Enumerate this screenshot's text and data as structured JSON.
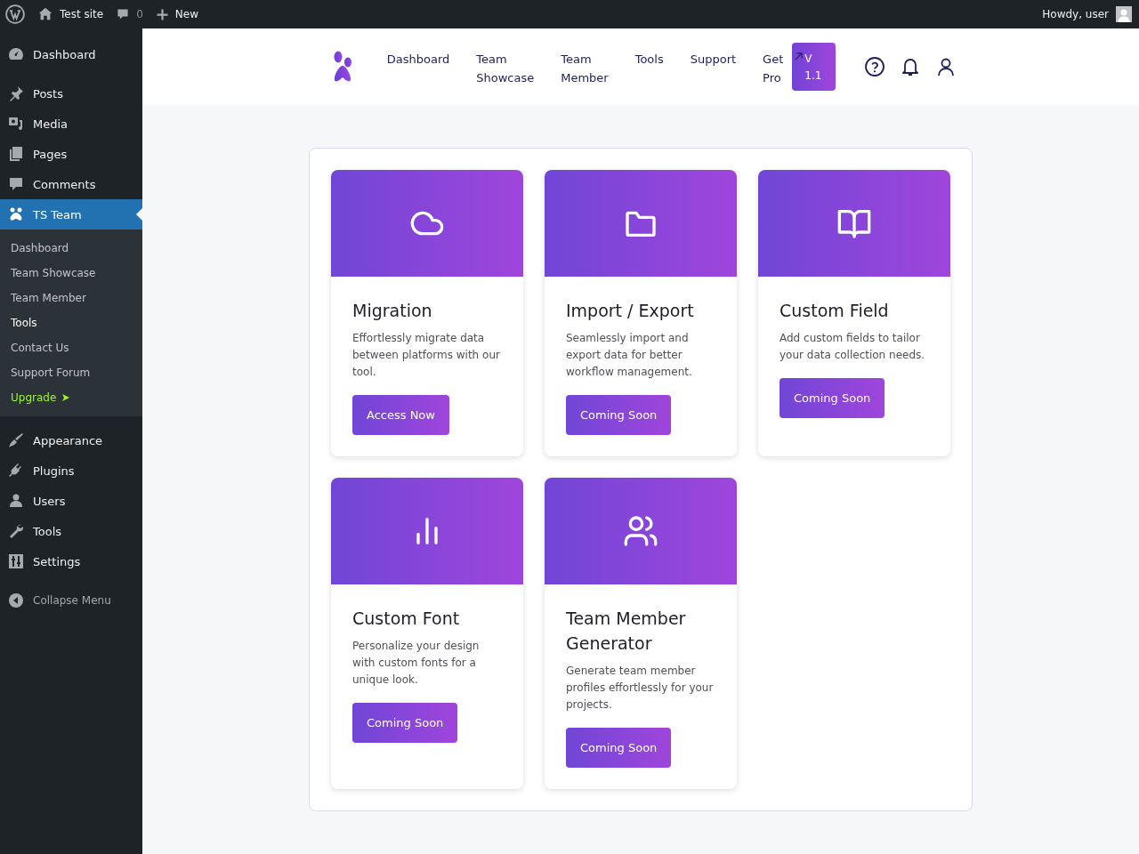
{
  "admin_bar": {
    "site": "Test site",
    "comments": "0",
    "new": "New",
    "greeting": "Howdy, user"
  },
  "sidebar": {
    "groups": [
      {
        "items": [
          {
            "label": "Dashboard",
            "selected": false
          }
        ]
      },
      {
        "items": [
          {
            "label": "Posts",
            "selected": false
          },
          {
            "label": "Media",
            "selected": false
          },
          {
            "label": "Pages",
            "selected": false
          },
          {
            "label": "Comments",
            "selected": false
          },
          {
            "label": "TS Team",
            "selected": true,
            "children": [
              {
                "label": "Dashboard",
                "kind": "link",
                "selected": false
              },
              {
                "label": "Team Showcase",
                "kind": "link",
                "selected": false
              },
              {
                "label": "Team Member",
                "kind": "link",
                "selected": false
              },
              {
                "label": "Tools",
                "kind": "link",
                "selected": true
              },
              {
                "label": "Contact Us",
                "kind": "link",
                "selected": false
              },
              {
                "label": "Support Forum",
                "kind": "link",
                "selected": false
              },
              {
                "label": "Upgrade",
                "kind": "upgrade"
              }
            ]
          }
        ]
      },
      {
        "items": [
          {
            "label": "Appearance",
            "selected": false
          },
          {
            "label": "Plugins",
            "selected": false
          },
          {
            "label": "Users",
            "selected": false
          },
          {
            "label": "Tools",
            "selected": false
          },
          {
            "label": "Settings",
            "selected": false
          }
        ]
      }
    ],
    "collapse": "Collapse Menu"
  },
  "header": {
    "nav": [
      "Dashboard",
      "Team Showcase",
      "Team Member",
      "Tools",
      "Support",
      "Get Pro"
    ],
    "version": "V 1.1"
  },
  "tools": [
    {
      "title": "Migration",
      "description": "Effortlessly migrate data between platforms with our tool.",
      "button": "Access Now"
    },
    {
      "title": "Import / Export",
      "description": "Seamlessly import and export data for better workflow management.",
      "button": "Coming Soon"
    },
    {
      "title": "Custom Field",
      "description": "Add custom fields to tailor your data collection needs.",
      "button": "Coming Soon"
    },
    {
      "title": "Custom Font",
      "description": "Personalize your design with custom fonts for a unique look.",
      "button": "Coming Soon"
    },
    {
      "title": "Team Member Generator",
      "description": "Generate team member profiles effortlessly for your projects.",
      "button": "Coming Soon"
    }
  ]
}
